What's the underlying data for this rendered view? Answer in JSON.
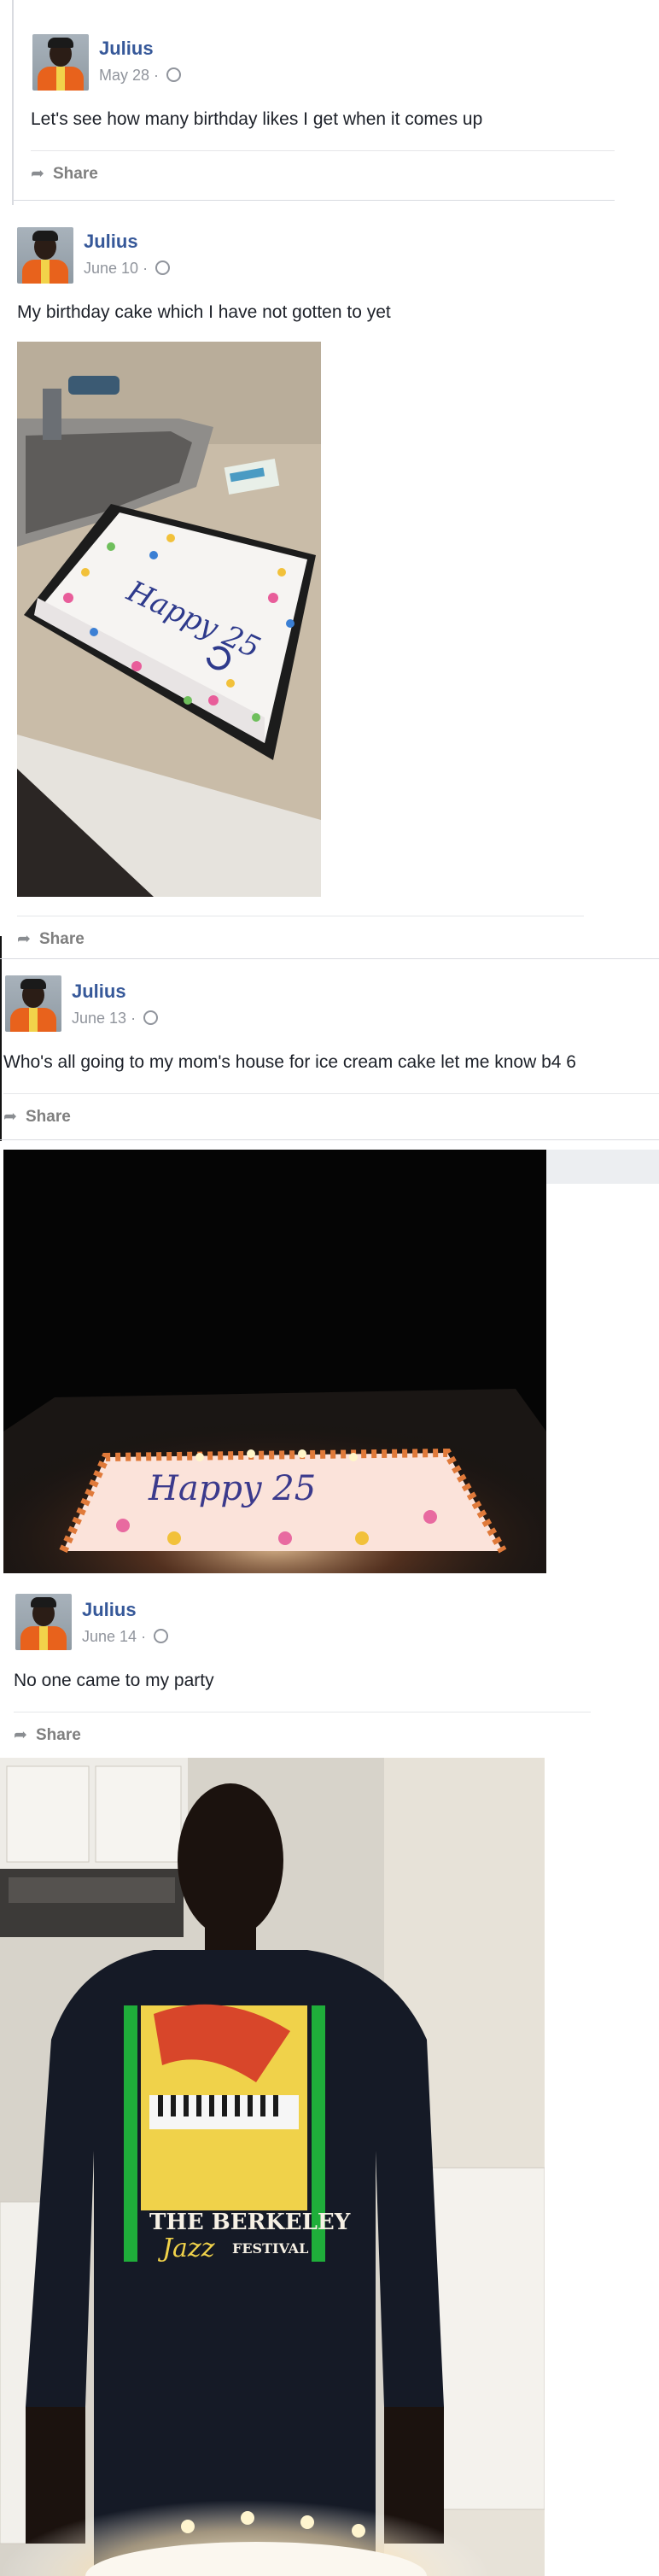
{
  "posts": [
    {
      "author": "Julius",
      "date": "May 28",
      "sep": "·",
      "text": "Let's see how many birthday likes I get when it comes up",
      "share": "Share"
    },
    {
      "author": "Julius",
      "date": "June 10",
      "sep": "·",
      "text": "My birthday cake which I have not gotten to yet",
      "share": "Share",
      "cake_text": "Happy 25"
    },
    {
      "author": "Julius",
      "date": "June 13",
      "sep": "·",
      "text": "Who's all going to my mom's house for ice cream cake let me know b4 6",
      "share": "Share",
      "cake_text": "Happy 25"
    },
    {
      "author": "Julius",
      "date": "June 14",
      "sep": "·",
      "text": "No one came to my party",
      "share": "Share",
      "shirt": {
        "line1": "THE BERKELEY",
        "line2": "Jazz",
        "line3": "FESTIVAL"
      }
    }
  ],
  "icons": {
    "share": "share-arrow-icon",
    "privacy": "globe-icon"
  },
  "colors": {
    "name": "#365899",
    "meta": "#90949c",
    "share": "#7f7f7f",
    "divider": "#e5e6e9"
  }
}
